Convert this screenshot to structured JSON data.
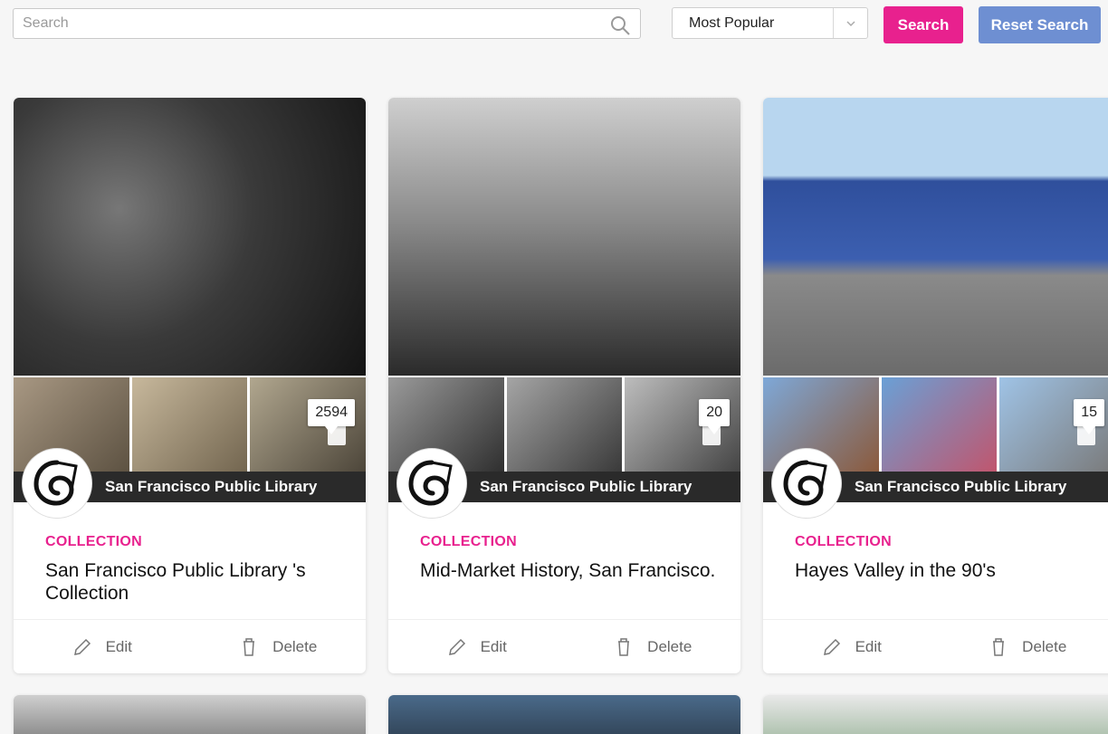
{
  "search": {
    "placeholder": "Search"
  },
  "sort": {
    "selected": "Most Popular"
  },
  "buttons": {
    "search": "Search",
    "reset": "Reset Search"
  },
  "cards": [
    {
      "owner": "San Francisco Public Library",
      "count": "2594",
      "kind": "COLLECTION",
      "title": "San Francisco Public Library 's Collection",
      "edit": "Edit",
      "delete": "Delete"
    },
    {
      "owner": "San Francisco Public Library",
      "count": "20",
      "kind": "COLLECTION",
      "title": "Mid-Market History, San Francisco.",
      "edit": "Edit",
      "delete": "Delete"
    },
    {
      "owner": "San Francisco Public Library",
      "count": "15",
      "kind": "COLLECTION",
      "title": "Hayes Valley in the 90's",
      "edit": "Edit",
      "delete": "Delete"
    }
  ],
  "colors": {
    "accent": "#e8218e",
    "secondary": "#6e8fd2"
  },
  "icons": [
    "search-icon",
    "chevron-down-icon",
    "pencil-icon",
    "trash-icon",
    "library-logo-icon",
    "speech-bubble-icon"
  ]
}
